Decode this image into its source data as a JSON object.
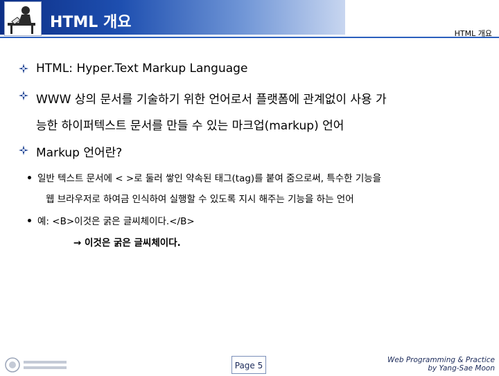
{
  "header": {
    "title": "HTML 개요",
    "right_label": "HTML 개요"
  },
  "body": {
    "item1": "HTML: Hyper.Text Markup Language",
    "item2_line1": "WWW 상의 문서를 기술하기 위한 언어로서 플랫폼에 관계없이 사용 가",
    "item2_line2": "능한 하이퍼텍스트 문서를 만들 수 있는 마크업(markup) 언어",
    "item3": "Markup 언어란?",
    "sub1_line1": "일반 텍스트 문서에 < >로 둘러 쌓인 약속된 태그(tag)를 붙여 줌으로써, 특수한 기능을",
    "sub1_line2": "웹 브라우저로 하여금 인식하여 실행할 수 있도록 지시 해주는 기능을 하는 언어",
    "sub2": "예: <B>이것은 굵은 글씨체이다.</B>",
    "result": "→ 이것은 굵은 글씨체이다."
  },
  "footer": {
    "page": "Page 5",
    "course_line1": "Web Programming & Practice",
    "course_line2": "by Yang-Sae Moon"
  },
  "colors": {
    "header_blue": "#0d2f86",
    "accent_line": "#2b5fbd"
  },
  "icons": {
    "bullet": "star-bullet-icon",
    "logo": "person-at-desk-logo",
    "footer_logo": "university-logo"
  }
}
